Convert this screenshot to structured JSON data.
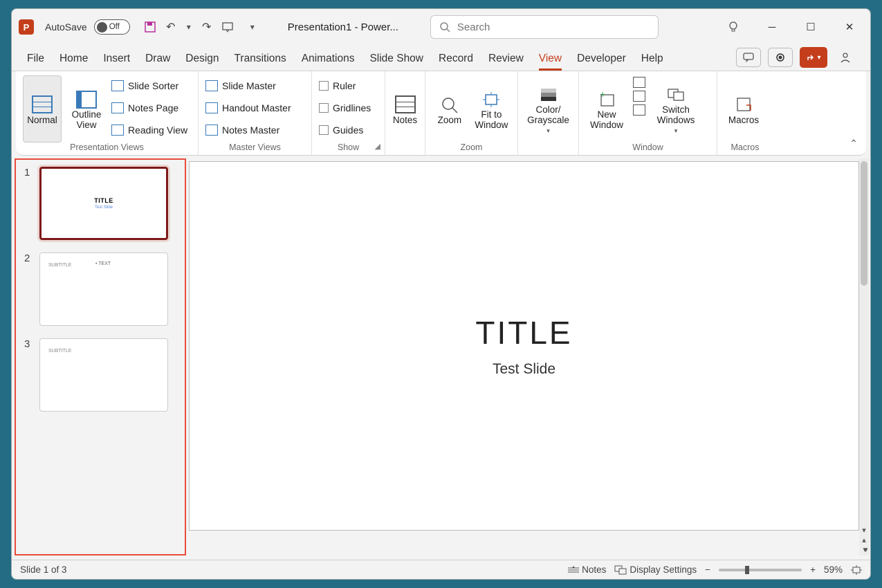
{
  "titlebar": {
    "autosave_label": "AutoSave",
    "autosave_state": "Off",
    "doc_title": "Presentation1  -  Power...",
    "search_placeholder": "Search"
  },
  "tabs": {
    "items": [
      "File",
      "Home",
      "Insert",
      "Draw",
      "Design",
      "Transitions",
      "Animations",
      "Slide Show",
      "Record",
      "Review",
      "View",
      "Developer",
      "Help"
    ],
    "active": "View"
  },
  "ribbon": {
    "presentation_views": {
      "label": "Presentation Views",
      "normal": "Normal",
      "outline": "Outline View",
      "slide_sorter": "Slide Sorter",
      "notes_page": "Notes Page",
      "reading_view": "Reading View"
    },
    "master_views": {
      "label": "Master Views",
      "slide_master": "Slide Master",
      "handout_master": "Handout Master",
      "notes_master": "Notes Master"
    },
    "show": {
      "label": "Show",
      "ruler": "Ruler",
      "gridlines": "Gridlines",
      "guides": "Guides"
    },
    "notes_group": {
      "notes": "Notes"
    },
    "zoom_group": {
      "label": "Zoom",
      "zoom": "Zoom",
      "fit": "Fit to Window"
    },
    "color_group": {
      "color_grayscale": "Color/ Grayscale"
    },
    "window_group": {
      "label": "Window",
      "new_window": "New Window",
      "switch_windows": "Switch Windows"
    },
    "macros_group": {
      "label": "Macros",
      "macros": "Macros"
    }
  },
  "thumbnails": [
    {
      "num": "1",
      "title": "TITLE",
      "subtitle": "Test Slide",
      "selected": true
    },
    {
      "num": "2",
      "subtitle_label": "SUBTITLE",
      "bullet": "• TEXT"
    },
    {
      "num": "3",
      "subtitle_label": "SUBTITLE"
    }
  ],
  "canvas": {
    "title": "TITLE",
    "subtitle": "Test Slide"
  },
  "statusbar": {
    "slide_info": "Slide 1 of 3",
    "notes": "Notes",
    "display_settings": "Display Settings",
    "zoom_pct": "59%"
  },
  "colors": {
    "accent": "#c43e1c",
    "highlight_border": "#e74c3c"
  }
}
